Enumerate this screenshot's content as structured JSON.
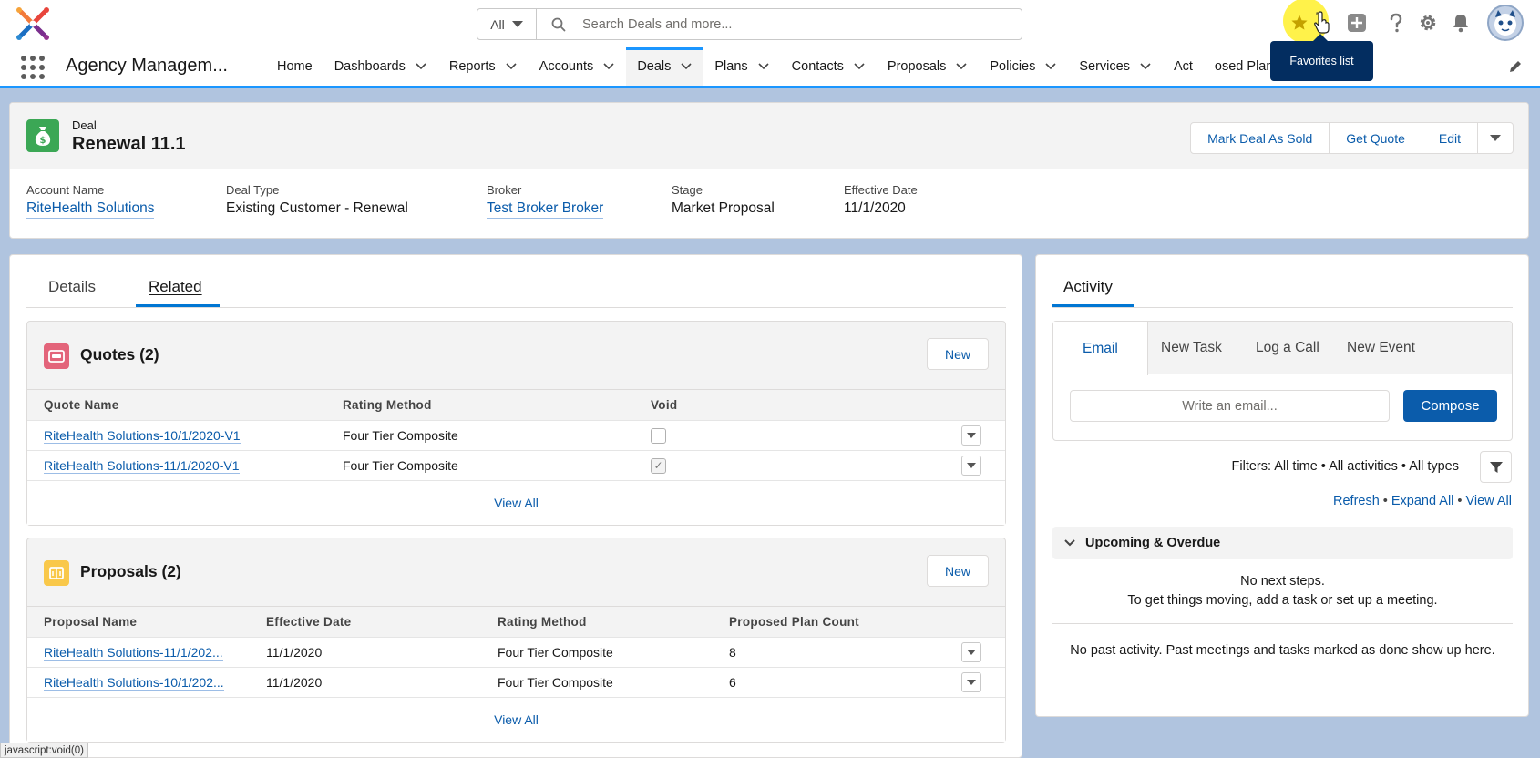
{
  "header": {
    "search_scope": "All",
    "search_placeholder": "Search Deals and more...",
    "tooltip": "Favorites list"
  },
  "nav": {
    "app_name": "Agency Managem...",
    "items": [
      {
        "label": "Home",
        "has_menu": false
      },
      {
        "label": "Dashboards",
        "has_menu": true
      },
      {
        "label": "Reports",
        "has_menu": true
      },
      {
        "label": "Accounts",
        "has_menu": true
      },
      {
        "label": "Deals",
        "has_menu": true,
        "active": true
      },
      {
        "label": "Plans",
        "has_menu": true
      },
      {
        "label": "Contacts",
        "has_menu": true
      },
      {
        "label": "Proposals",
        "has_menu": true
      },
      {
        "label": "Policies",
        "has_menu": true
      },
      {
        "label": "Services",
        "has_menu": true
      },
      {
        "label": "Act",
        "has_menu": false
      },
      {
        "label": "osed Plans",
        "has_menu": true
      }
    ]
  },
  "record": {
    "object_type": "Deal",
    "title": "Renewal 11.1",
    "actions": [
      "Mark Deal As Sold",
      "Get Quote",
      "Edit"
    ],
    "fields": [
      {
        "label": "Account Name",
        "value": "RiteHealth Solutions"
      },
      {
        "label": "Deal Type",
        "value": "Existing Customer - Renewal"
      },
      {
        "label": "Broker",
        "value": "Test Broker Broker"
      },
      {
        "label": "Stage",
        "value": "Market Proposal"
      },
      {
        "label": "Effective Date",
        "value": "11/1/2020"
      }
    ]
  },
  "tabs": {
    "details": "Details",
    "related": "Related"
  },
  "quotes": {
    "title": "Quotes (2)",
    "new_label": "New",
    "columns": [
      "Quote Name",
      "Rating Method",
      "Void"
    ],
    "rows": [
      {
        "name": "RiteHealth Solutions-10/1/2020-V1",
        "rating": "Four Tier Composite",
        "void": false
      },
      {
        "name": "RiteHealth Solutions-11/1/2020-V1",
        "rating": "Four Tier Composite",
        "void": true
      }
    ],
    "view_all": "View All"
  },
  "proposals": {
    "title": "Proposals (2)",
    "new_label": "New",
    "columns": [
      "Proposal Name",
      "Effective Date",
      "Rating Method",
      "Proposed Plan Count"
    ],
    "rows": [
      {
        "name": "RiteHealth Solutions-11/1/202...",
        "date": "11/1/2020",
        "rating": "Four Tier Composite",
        "count": "8"
      },
      {
        "name": "RiteHealth Solutions-10/1/202...",
        "date": "11/1/2020",
        "rating": "Four Tier Composite",
        "count": "6"
      }
    ],
    "view_all": "View All"
  },
  "activity": {
    "title": "Activity",
    "tabs": [
      "Email",
      "New Task",
      "Log a Call",
      "New Event"
    ],
    "email_placeholder": "Write an email...",
    "compose": "Compose",
    "filters": "Filters: All time • All activities • All types",
    "links": [
      "Refresh",
      "Expand All",
      "View All"
    ],
    "upcoming": "Upcoming & Overdue",
    "no_steps_1": "No next steps.",
    "no_steps_2": "To get things moving, add a task or set up a meeting.",
    "no_past": "No past activity. Past meetings and tasks marked as done show up here."
  },
  "statusbar": "javascript:void(0)",
  "colors": {
    "brand": "#0b5cab",
    "nav_accent": "#1b96ff",
    "deal_icon": "#3ba755",
    "quote_icon": "#e3647a",
    "proposal_icon": "#f9c84a",
    "page_bg": "#b0c4df"
  }
}
